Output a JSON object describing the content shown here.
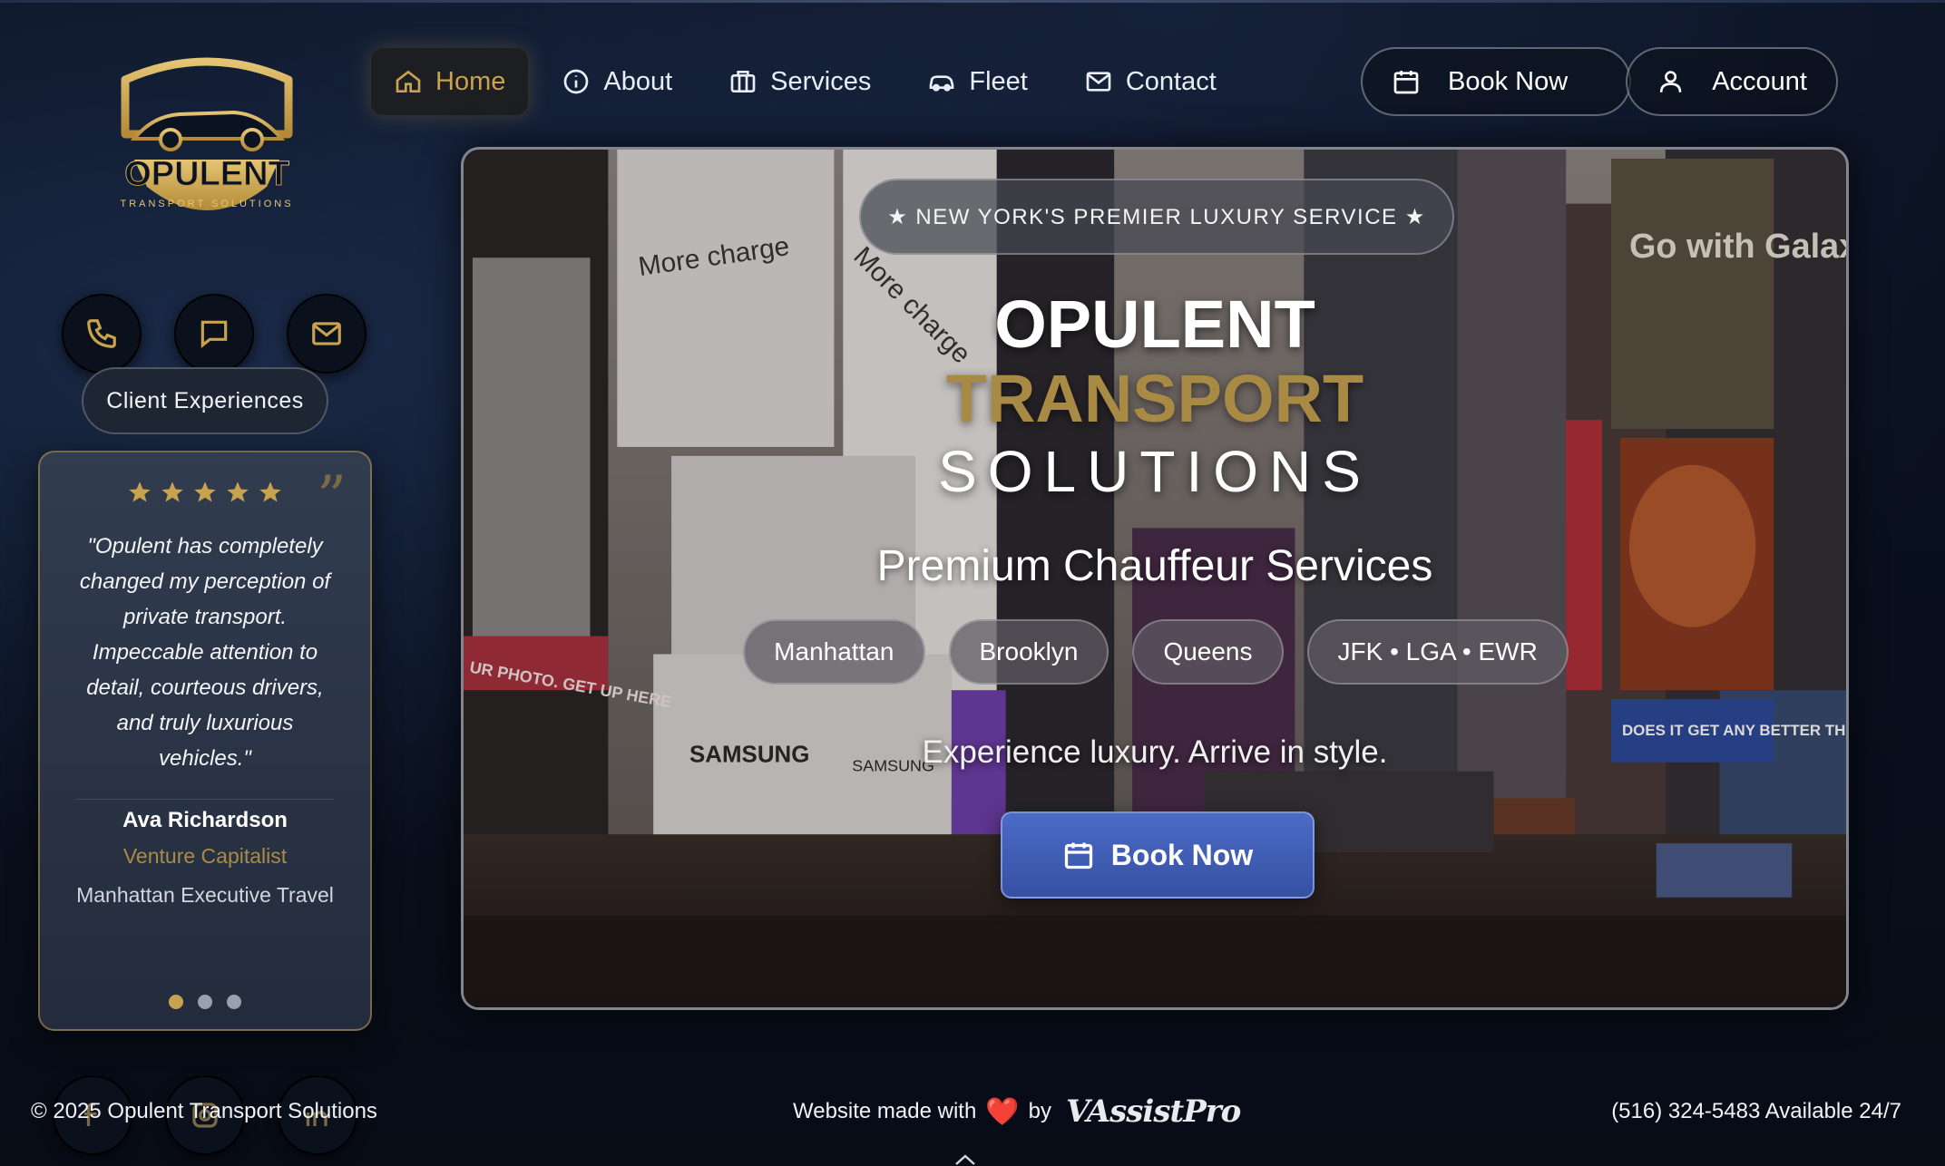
{
  "brand": {
    "logo_title": "OPULENT",
    "logo_subtitle": "TRANSPORT SOLUTIONS",
    "accent_color": "#c9a24f"
  },
  "nav": {
    "items": [
      {
        "label": "Home",
        "icon": "home-icon",
        "active": true
      },
      {
        "label": "About",
        "icon": "info-icon"
      },
      {
        "label": "Services",
        "icon": "briefcase-icon"
      },
      {
        "label": "Fleet",
        "icon": "car-icon"
      },
      {
        "label": "Contact",
        "icon": "mail-icon"
      }
    ],
    "book_label": "Book Now",
    "account_label": "Account"
  },
  "contact_icons": [
    "phone-icon",
    "chat-icon",
    "mail-icon"
  ],
  "testimonials": {
    "section_label": "Client Experiences",
    "rating": 5,
    "quote": "\"Opulent has completely changed my perception of private transport. Impeccable attention to detail, courteous drivers, and truly luxurious vehicles.\"",
    "name": "Ava Richardson",
    "role": "Venture Capitalist",
    "company": "Manhattan Executive Travel",
    "slides": 3,
    "active_slide": 1
  },
  "hero": {
    "badge": "★ NEW YORK'S PREMIER LUXURY SERVICE ★",
    "title_line1": "OPULENT",
    "title_line2": "TRANSPORT",
    "title_line3": "SOLUTIONS",
    "subtitle": "Premium Chauffeur Services",
    "locations": [
      "Manhattan",
      "Brooklyn",
      "Queens",
      "JFK • LGA • EWR"
    ],
    "tagline": "Experience luxury. Arrive in style.",
    "cta_label": "Book Now",
    "background_signs": [
      "More charge",
      "More charge",
      "Go with Galaxy",
      "DOES IT GET ANY BETTER THAN THIS?",
      "SAMSUNG",
      "SAMSUNG",
      "UR PHOTO. GET UP HERE"
    ]
  },
  "footer": {
    "copyright": "© 2025 Opulent Transport Solutions",
    "made_with": "Website made with",
    "heart": "❤️",
    "by": "by",
    "maker": "VAssistPro",
    "phone": "(516) 324-5483 Available 24/7",
    "social_icons": [
      "facebook-icon",
      "instagram-icon",
      "linkedin-icon"
    ]
  }
}
